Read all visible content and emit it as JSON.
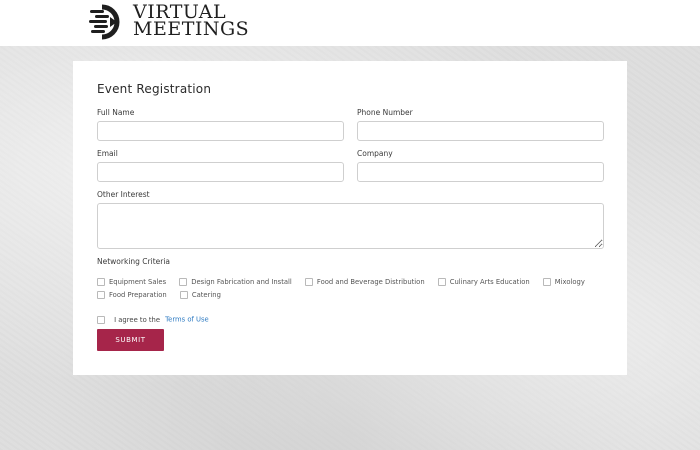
{
  "header": {
    "logo_line1": "VIRTUAL",
    "logo_line2": "MEETINGS"
  },
  "form": {
    "title": "Event Registration",
    "fields": {
      "full_name": {
        "label": "Full Name",
        "value": ""
      },
      "phone": {
        "label": "Phone Number",
        "value": ""
      },
      "email": {
        "label": "Email",
        "value": ""
      },
      "company": {
        "label": "Company",
        "value": ""
      },
      "other_interest": {
        "label": "Other Interest",
        "value": ""
      }
    },
    "networking": {
      "label": "Networking Criteria",
      "options": [
        "Equipment Sales",
        "Design Fabrication and Install",
        "Food and Beverage Distribution",
        "Culinary Arts Education",
        "Mixology",
        "Food Preparation",
        "Catering"
      ]
    },
    "agree": {
      "text": "I agree to the",
      "link": "Terms of Use"
    },
    "submit_label": "SUBMIT"
  },
  "colors": {
    "accent": "#a6254a",
    "link": "#2b79c2"
  }
}
